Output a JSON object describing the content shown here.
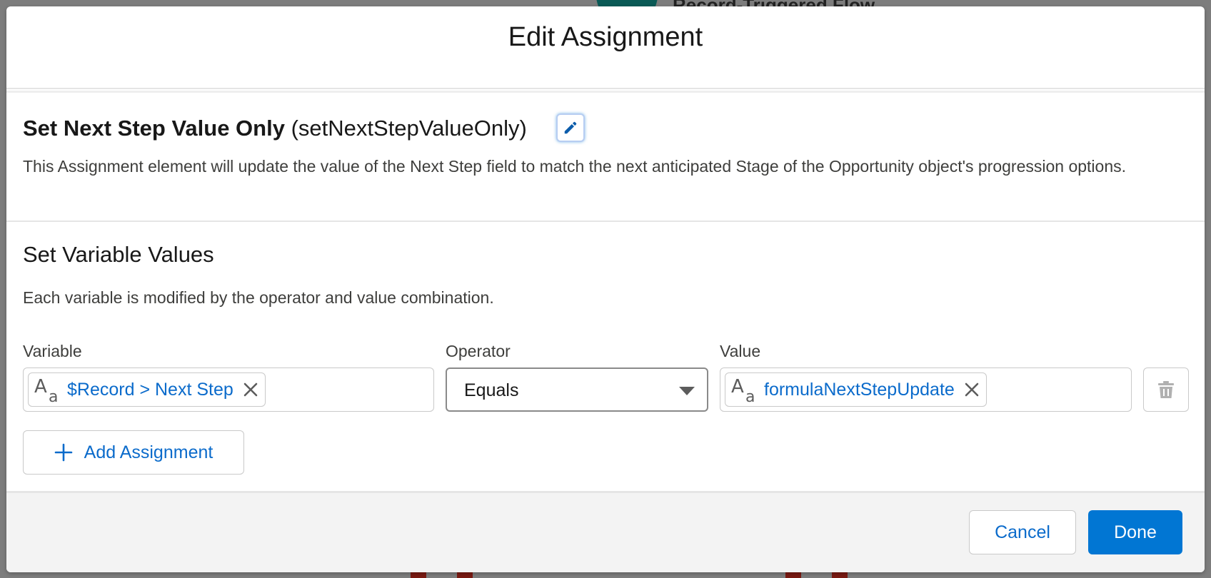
{
  "background": {
    "node_title": "Record-Triggered Flow"
  },
  "modal": {
    "title": "Edit Assignment"
  },
  "element": {
    "label": "Set Next Step Value Only",
    "api_name": "(setNextStepValueOnly)",
    "description": "This Assignment element will update the value of the Next Step field to match the next anticipated Stage of the Opportunity object's progression options.",
    "edit_icon": "pencil-icon"
  },
  "variables_section": {
    "title": "Set Variable Values",
    "description": "Each variable is modified by the operator and value combination.",
    "columns": {
      "variable": "Variable",
      "operator": "Operator",
      "value": "Value"
    },
    "row": {
      "variable": "$Record > Next Step",
      "variable_icon": "text-type-icon",
      "operator": "Equals",
      "value": "formulaNextStepUpdate",
      "value_icon": "text-type-icon",
      "delete_icon": "trash-icon"
    },
    "add_label": "Add Assignment"
  },
  "footer": {
    "cancel_label": "Cancel",
    "done_label": "Done"
  },
  "colors": {
    "brand": "#0176d3",
    "link": "#0b6bcb",
    "text": "#181818"
  }
}
